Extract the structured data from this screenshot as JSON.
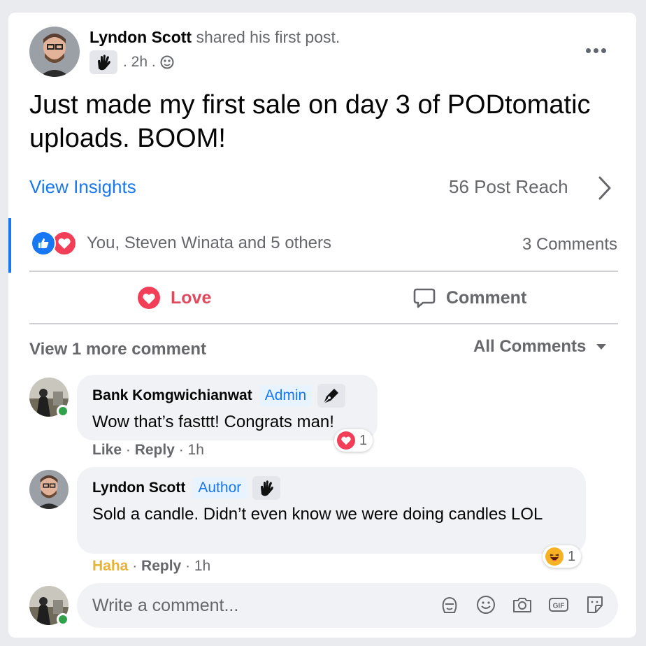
{
  "post": {
    "author": "Lyndon Scott",
    "action": "shared his first post.",
    "time": ". 2h .",
    "text": "Just made my first sale on day 3 of PODtomatic uploads. BOOM!",
    "insights_label": "View Insights",
    "reach_label": "56 Post Reach",
    "reactors": "You, Steven Winata and 5 others",
    "comments_count": "3 Comments"
  },
  "actions": {
    "love_label": "Love",
    "comment_label": "Comment"
  },
  "comments_header": {
    "view_more": "View 1 more comment",
    "filter": "All Comments"
  },
  "comments": [
    {
      "name": "Bank Komgwichianwat",
      "role": "Admin",
      "text": "Wow that’s fasttt! Congrats man!",
      "reaction_count": "1",
      "like_label": "Like",
      "sep1": " · ",
      "reply_label": "Reply",
      "time": " · 1h"
    },
    {
      "name": "Lyndon Scott",
      "role": "Author",
      "text": "Sold a candle. Didn’t even know we were doing candles LOL",
      "reaction_count": "1",
      "like_label": "Haha",
      "sep1": " · ",
      "reply_label": "Reply",
      "time": " · 1h"
    }
  ],
  "composer": {
    "placeholder": "Write a comment..."
  },
  "colors": {
    "accent": "#1877f2",
    "love": "#f33e58",
    "haha": "#e8b33a",
    "online": "#31a24c"
  },
  "icons": [
    "wave-badge-icon",
    "globe-icon",
    "more-icon",
    "chevron-right-icon",
    "like-icon",
    "love-icon",
    "comment-icon",
    "caret-down-icon",
    "pen-badge-icon",
    "haha-icon",
    "sticker-icon",
    "emoji-icon",
    "camera-icon",
    "gif-icon",
    "avatar-icon"
  ]
}
